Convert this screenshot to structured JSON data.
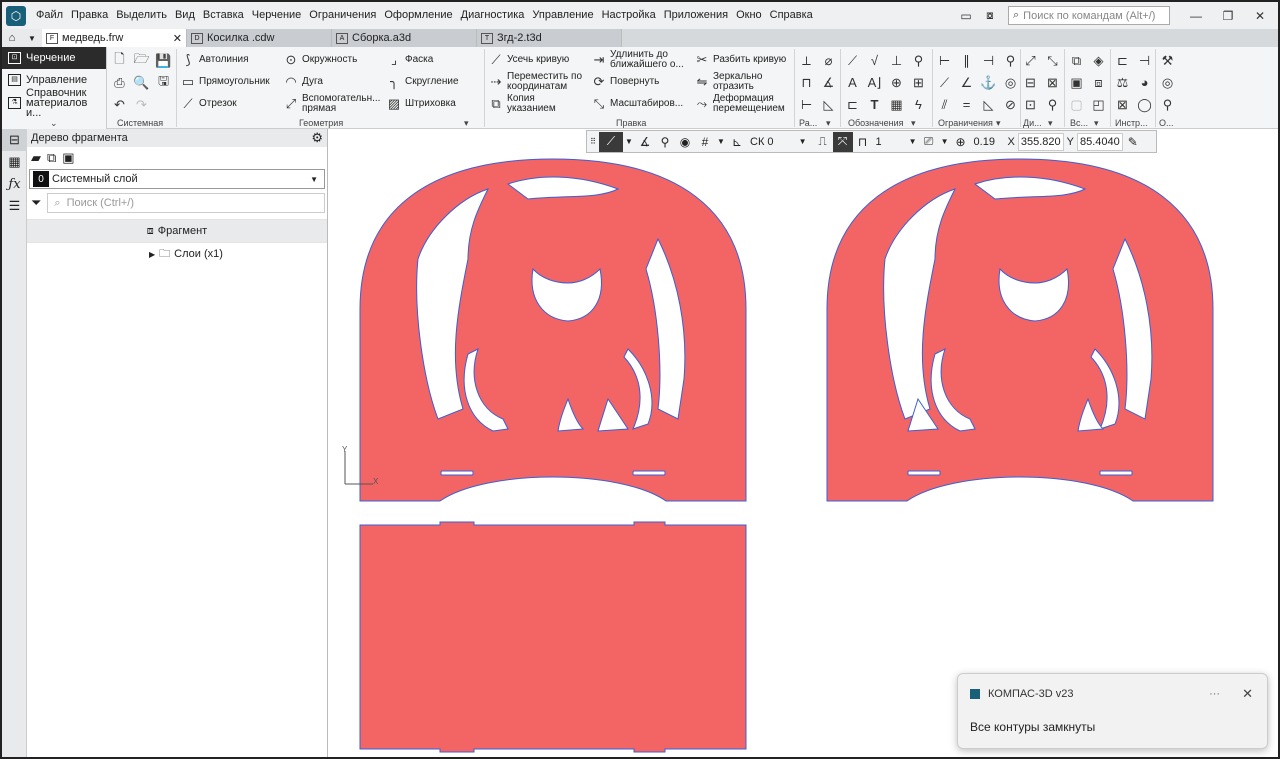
{
  "menu": {
    "items": [
      "Файл",
      "Правка",
      "Выделить",
      "Вид",
      "Вставка",
      "Черчение",
      "Ограничения",
      "Оформление",
      "Диагностика",
      "Управление",
      "Настройка",
      "Приложения",
      "Окно",
      "Справка"
    ],
    "search_placeholder": "Поиск по командам (Alt+/)"
  },
  "tabs": [
    {
      "label": "медведь.frw",
      "active": true
    },
    {
      "label": "Косилка .cdw",
      "active": false
    },
    {
      "label": "Сборка.a3d",
      "active": false
    },
    {
      "label": "Згд-2.t3d",
      "active": false
    }
  ],
  "modes": [
    {
      "label": "Черчение",
      "active": true
    },
    {
      "label": "Управление",
      "active": false
    },
    {
      "label": "Справочник материалов и...",
      "active": false
    }
  ],
  "ribbon": {
    "groups": {
      "system": "Системная",
      "geometry": "Геометрия",
      "edit": "Правка",
      "ra": "Ра...",
      "annotations": "Обозначения",
      "constraints": "Ограничения",
      "di": "Ди...",
      "vs": "Вс...",
      "instr": "Инстр...",
      "o": "О..."
    },
    "geometry": {
      "autoline": "Автолиния",
      "rectangle": "Прямоугольник",
      "segment": "Отрезок",
      "circle": "Окружность",
      "arc": "Дуга",
      "aux_line": "Вспомогательн... прямая",
      "chamfer": "Фаска",
      "fillet": "Скругление",
      "hatch": "Штриховка"
    },
    "edit": {
      "trim": "Усечь кривую",
      "move_coords": "Переместить по координатам",
      "copy": "Копия указанием",
      "extend": "Удлинить до ближайшего о...",
      "rotate": "Повернуть",
      "scale": "Масштабиров...",
      "split": "Разбить кривую",
      "mirror": "Зеркально отразить",
      "deform": "Деформация перемещением"
    }
  },
  "tree": {
    "title": "Дерево фрагмента",
    "layer_num": "0",
    "layer_name": "Системный слой",
    "search_placeholder": "Поиск (Ctrl+/)",
    "fragment": "Фрагмент",
    "layers": "Слои (x1)"
  },
  "floatbar": {
    "cs": "СК 0",
    "step": "1",
    "zoom": "0.19",
    "x_label": "X",
    "x_value": "355.820",
    "y_label": "Y",
    "y_value": "85.4040"
  },
  "axis": {
    "x": "X",
    "y": "Y"
  },
  "colors": {
    "fill": "#f36464",
    "outline": "#3b5fd6",
    "accent": "#1a5f7a"
  },
  "toast": {
    "app": "КОМПАС-3D v23",
    "more": "···",
    "message": "Все контуры замкнуты"
  }
}
